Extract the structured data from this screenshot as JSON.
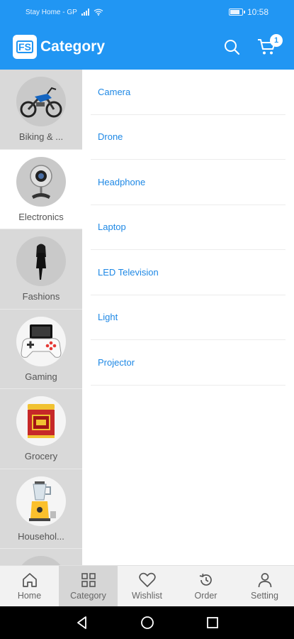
{
  "status_bar": {
    "carrier": "Stay Home - GP",
    "time": "10:58"
  },
  "app_bar": {
    "logo_text": "FS",
    "title": "Category",
    "cart_count": "1"
  },
  "categories": [
    {
      "label": "Biking & ...",
      "icon": "motorbike-image",
      "selected": false
    },
    {
      "label": "Electronics",
      "icon": "webcam-image",
      "selected": true
    },
    {
      "label": "Fashions",
      "icon": "fashion-model-image",
      "selected": false
    },
    {
      "label": "Gaming",
      "icon": "gamepad-image",
      "selected": false
    },
    {
      "label": "Grocery",
      "icon": "tea-tin-image",
      "selected": false
    },
    {
      "label": "Househol...",
      "icon": "blender-image",
      "selected": false
    }
  ],
  "subcategories": [
    "Camera",
    "Drone",
    "Headphone",
    "Laptop",
    "LED Television",
    "Light",
    "Projector"
  ],
  "bottom_nav": [
    {
      "label": "Home",
      "icon": "home-icon"
    },
    {
      "label": "Category",
      "icon": "grid-icon",
      "active": true
    },
    {
      "label": "Wishlist",
      "icon": "heart-icon"
    },
    {
      "label": "Order",
      "icon": "history-icon"
    },
    {
      "label": "Setting",
      "icon": "person-icon"
    }
  ],
  "colors": {
    "primary": "#2196f3",
    "link": "#1e88e5",
    "sidebar_bg": "#d9d9d9"
  }
}
